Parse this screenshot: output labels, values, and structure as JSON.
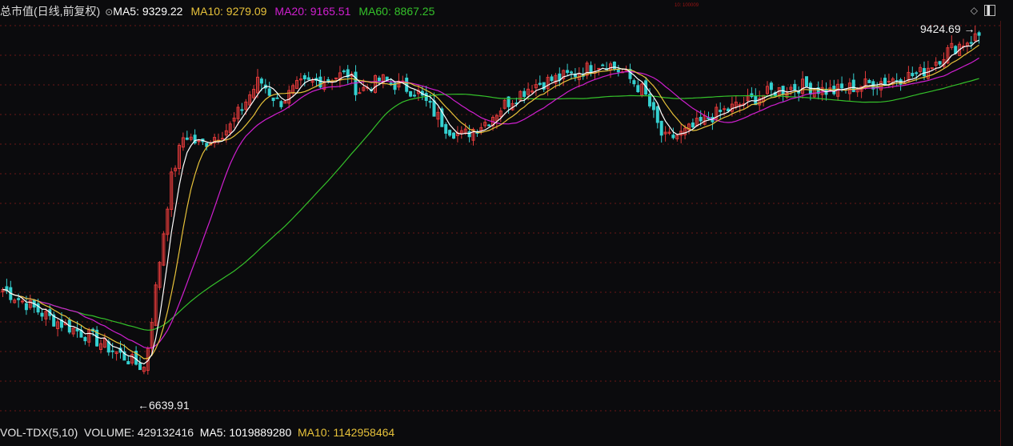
{
  "legend": {
    "title": "总市值(日线,前复权)",
    "ma5": "MA5: 9329.22",
    "ma10": "MA10: 9279.09",
    "ma20": "MA20: 9165.51",
    "ma60": "MA60: 8867.25",
    "small_label": "10: 100009"
  },
  "chart": {
    "high_label": "9424.69",
    "low_label": "6639.91"
  },
  "volume": {
    "name": "VOL-TDX(5,10)",
    "volume": "VOLUME: 429132416",
    "ma5": "MA5: 1019889280",
    "ma10": "MA10: 1142958464"
  },
  "colors": {
    "up": "#e23a3a",
    "down": "#35d0d0",
    "ma5": "#ffffff",
    "ma10": "#e7c23a",
    "ma20": "#d01fd0",
    "ma60": "#34c12a",
    "grid": "#6b1717"
  },
  "icons": {
    "options": "chevron-circle-icon",
    "diamond": "diamond-icon",
    "panel": "panel-toggle-icon"
  },
  "chart_data": {
    "type": "candlestick",
    "ma5_last": 9329.22,
    "ma10_last": 9279.09,
    "ma20_last": 9165.51,
    "ma60_last": 8867.25,
    "max": 9424.69,
    "min": 6639.91,
    "volume": 429132416,
    "vol_ma5": 1019889280,
    "vol_ma10": 1142958464
  }
}
